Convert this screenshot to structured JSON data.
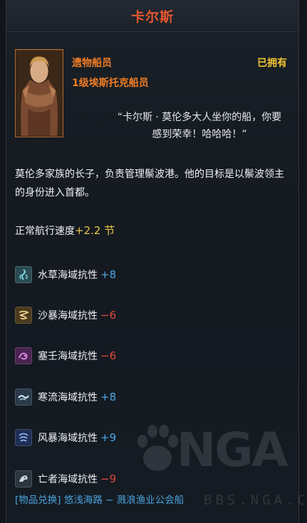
{
  "title": "卡尔斯",
  "crew": {
    "name": "遗物船员",
    "status": "已拥有",
    "level": "1级埃斯托克船员",
    "quote": "“卡尔斯 · 莫伦多大人坐你的船，你要感到荣幸！哈哈哈！”"
  },
  "description": "莫伦多家族的长子，负责管理鬃波港。他的目标是以鬃波领主的身份进入首都。",
  "speed": {
    "label": "正常航行速度",
    "value": "+2.2 节"
  },
  "resistances": [
    {
      "label": "水草海域抗性",
      "value": "+8",
      "sign": "pos",
      "icon": "seaweed-icon",
      "color": "#2a4a52"
    },
    {
      "label": "沙暴海域抗性",
      "value": "−6",
      "sign": "neg",
      "icon": "sandstorm-icon",
      "color": "#4b3a1e"
    },
    {
      "label": "塞壬海域抗性",
      "value": "−6",
      "sign": "neg",
      "icon": "siren-icon",
      "color": "#4a2452"
    },
    {
      "label": "寒流海域抗性",
      "value": "+8",
      "sign": "pos",
      "icon": "cold-current-icon",
      "color": "#2b3a4a"
    },
    {
      "label": "风暴海域抗性",
      "value": "+9",
      "sign": "pos",
      "icon": "storm-icon",
      "color": "#1f2e55"
    },
    {
      "label": "亡者海域抗性",
      "value": "−9",
      "sign": "neg",
      "icon": "dead-sea-icon",
      "color": "#2c3640"
    }
  ],
  "footer": "[物品兑换] 悠浅海路 − 溅浪渔业公会船",
  "watermark": {
    "text": "NGA",
    "url": "BBS.NGA.CN"
  }
}
